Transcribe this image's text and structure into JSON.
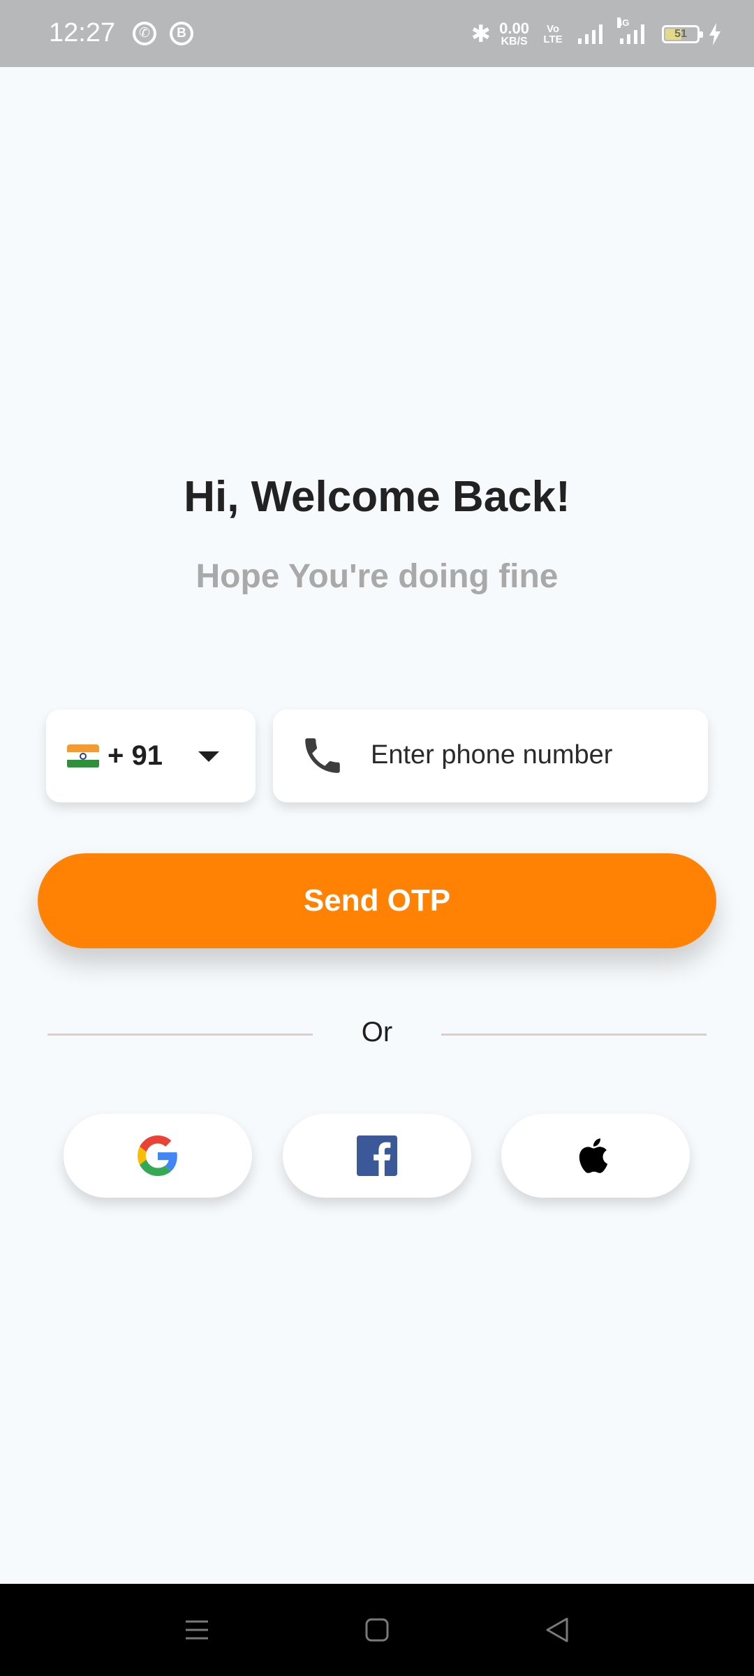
{
  "status_bar": {
    "time": "12:27",
    "app_icons": [
      "whatsapp-icon",
      "business-b-icon"
    ],
    "network_speed_value": "0.00",
    "network_speed_unit": "KB/S",
    "volte_label": "Vo LTE",
    "network_type": "4G",
    "battery_level": "51",
    "charging": true
  },
  "main": {
    "title": "Hi, Welcome Back!",
    "subtitle": "Hope You're doing fine"
  },
  "phone_form": {
    "country_code": "+ 91",
    "country_flag": "india-flag",
    "phone_placeholder": "Enter phone number",
    "phone_value": ""
  },
  "send_button": {
    "label": "Send OTP",
    "color": "#ff8205"
  },
  "divider": {
    "label": "Or"
  },
  "social_login": [
    {
      "name": "google",
      "icon": "google-icon"
    },
    {
      "name": "facebook",
      "icon": "facebook-icon"
    },
    {
      "name": "apple",
      "icon": "apple-icon"
    }
  ],
  "nav_bar": {
    "buttons": [
      "menu-icon",
      "home-square-icon",
      "back-triangle-icon"
    ]
  }
}
